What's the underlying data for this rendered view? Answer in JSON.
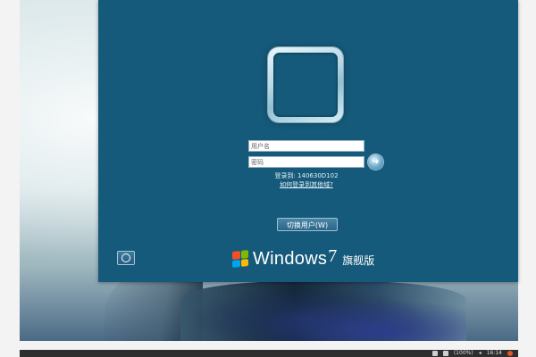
{
  "logon": {
    "username_placeholder": "用户名",
    "password_placeholder": "密码",
    "login_to": "登录到: 140630D102",
    "how_link": "如何登录到其他域?",
    "switch_user_label": "切换用户(W)",
    "go_glyph": "➜"
  },
  "brand": {
    "name": "Windows",
    "version": "7",
    "edition": "旗舰版"
  },
  "taskbar": {
    "battery": "(100%)",
    "volume_glyph": "◂",
    "time": "16:14"
  },
  "colors": {
    "logon_background": "#155a7a",
    "accent": "#f25022"
  },
  "icons": [
    "user-tile-frame",
    "arrow-right-icon",
    "ease-of-access-icon",
    "windows-flag-icon",
    "network-icon",
    "volume-icon",
    "battery-icon",
    "power-icon"
  ]
}
